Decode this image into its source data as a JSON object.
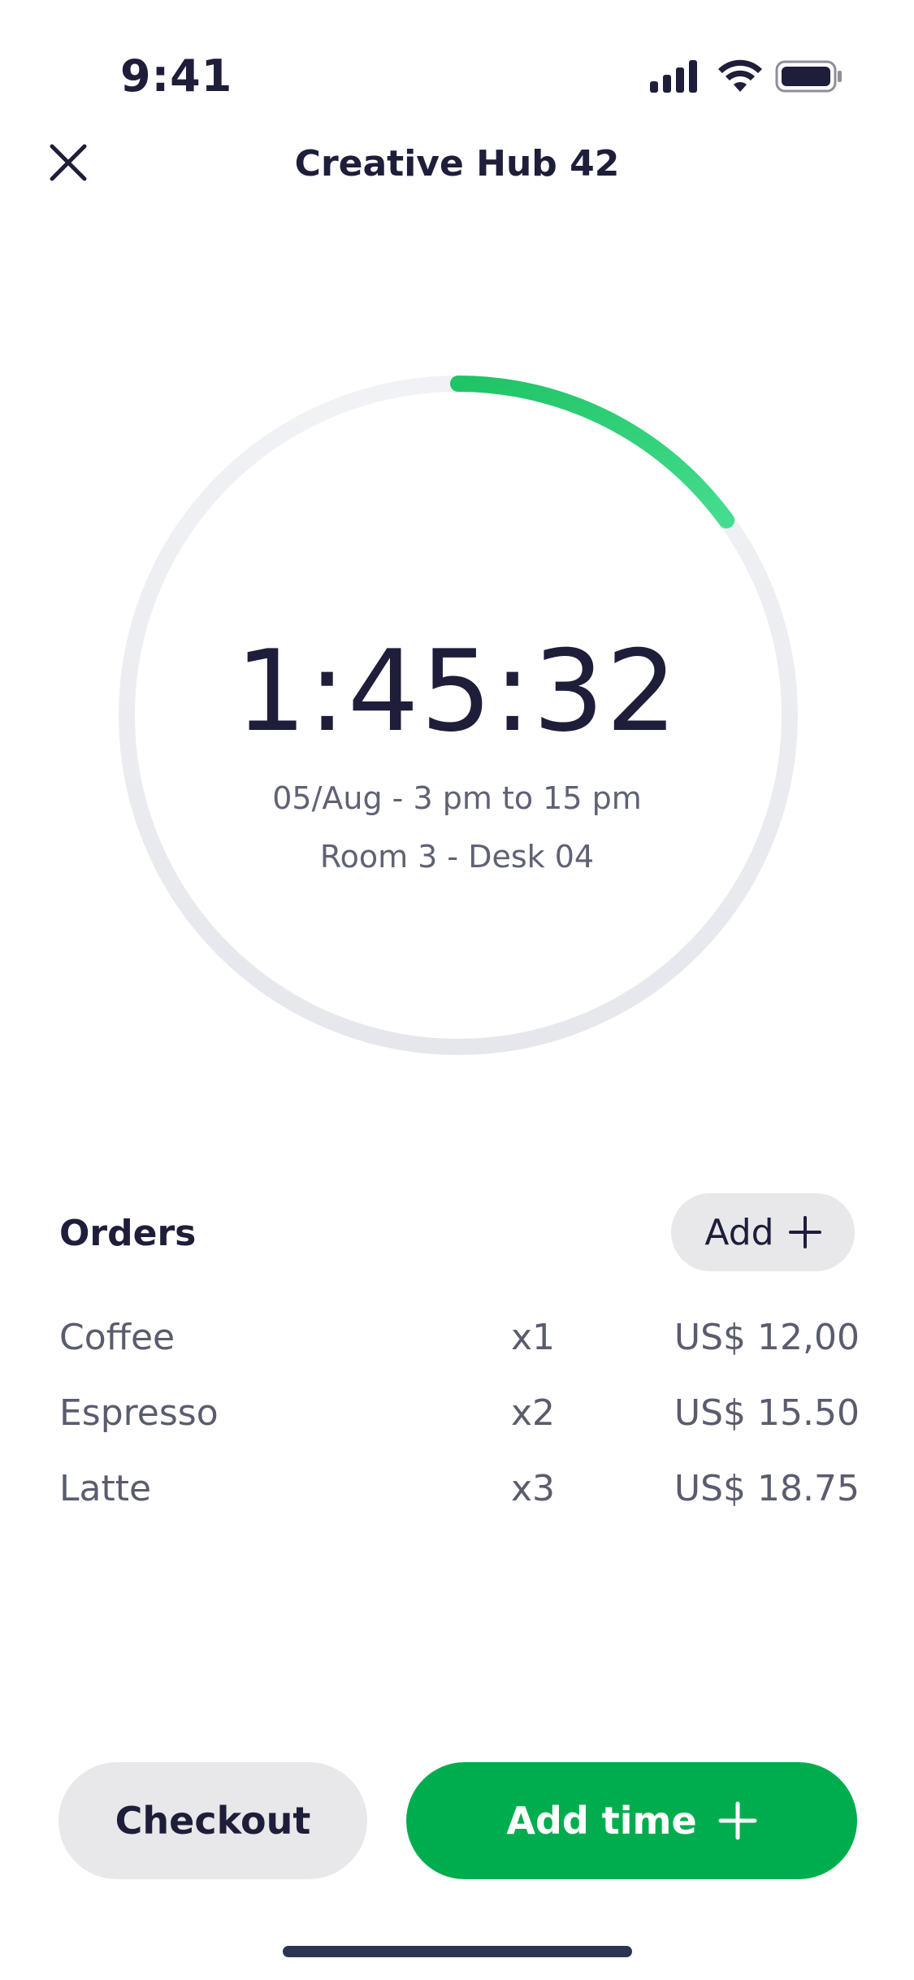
{
  "status_bar": {
    "time": "9:41",
    "icons": [
      "cellular-signal-icon",
      "wifi-icon",
      "battery-icon"
    ]
  },
  "header": {
    "title": "Creative Hub 42",
    "close_icon": "close-icon"
  },
  "timer": {
    "remaining": "1:45:32",
    "date_range": "05/Aug - 3 pm to 15 pm",
    "location": "Room 3 - Desk 04",
    "progress_fraction": 0.15,
    "track_color": "#eceef2",
    "progress_color": "#27c96a"
  },
  "orders": {
    "heading": "Orders",
    "add_label": "Add",
    "add_icon": "plus-icon",
    "items": [
      {
        "name": "Coffee",
        "qty": "x1",
        "price": "US$ 12,00"
      },
      {
        "name": "Espresso",
        "qty": "x2",
        "price": "US$ 15.50"
      },
      {
        "name": "Latte",
        "qty": "x3",
        "price": "US$ 18.75"
      }
    ]
  },
  "actions": {
    "checkout_label": "Checkout",
    "add_time_label": "Add time",
    "add_time_icon": "plus-icon",
    "primary_color": "#00ad4e"
  }
}
